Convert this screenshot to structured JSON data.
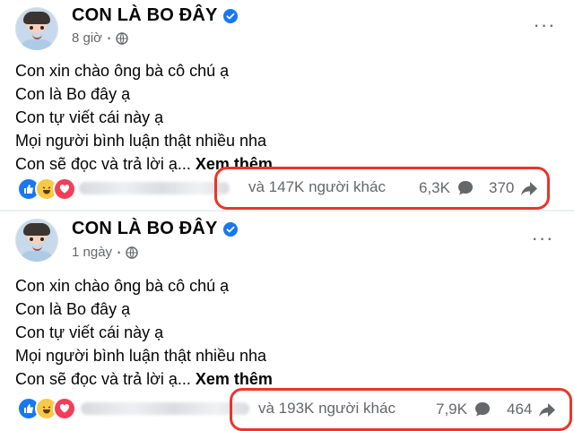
{
  "posts": [
    {
      "page_name": "CON LÀ BO ĐÂY",
      "time": "8 giờ",
      "lines": [
        "Con xin chào ông bà cô chú ạ",
        "Con là Bo đây ạ",
        "Con tự viết cái này ạ",
        "Mọi người bình luận thật nhiều nha",
        "Con sẽ đọc và trả lời ạ..."
      ],
      "see_more": "Xem thêm",
      "others_text": "và 147K người khác",
      "comments": "6,3K",
      "shares": "370"
    },
    {
      "page_name": "CON LÀ BO ĐÂY",
      "time": "1 ngày",
      "lines": [
        "Con xin chào ông bà cô chú ạ",
        "Con là Bo đây ạ",
        "Con tự viết cái này ạ",
        "Mọi người bình luận thật nhiều nha",
        "Con sẽ đọc và trả lời ạ..."
      ],
      "see_more": "Xem thêm",
      "others_text": "và 193K người khác",
      "comments": "7,9K",
      "shares": "464"
    }
  ],
  "more_label": "···",
  "icons": {
    "verified": "verified-badge-icon",
    "privacy": "globe-icon",
    "comment": "comment-bubble-icon",
    "share": "share-arrow-icon",
    "reactions": [
      "like-icon",
      "haha-icon",
      "love-icon"
    ]
  },
  "colors": {
    "brand_blue": "#1877f2",
    "highlight_red": "#e8362b",
    "meta_gray": "#65676b"
  }
}
